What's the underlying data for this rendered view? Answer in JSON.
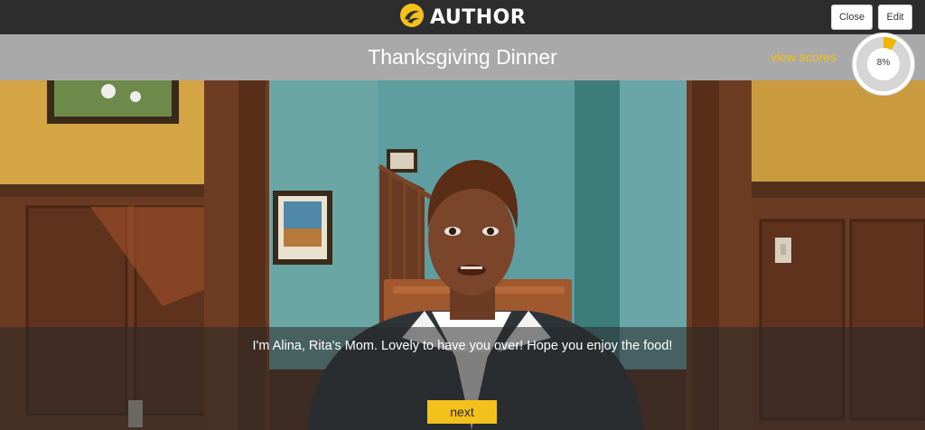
{
  "app": {
    "brand": "AUTHOR",
    "logo_icon": "author-logo-icon"
  },
  "header": {
    "close_label": "Close",
    "edit_label": "Edit"
  },
  "scene": {
    "title": "Thanksgiving Dinner",
    "view_scores_label": "view scores"
  },
  "progress": {
    "value": 0.08,
    "label": "8%"
  },
  "dialog": {
    "text": "I'm Alina, Rita's Mom. Lovely to have you over! Hope you enjoy the food!",
    "next_label": "next"
  },
  "colors": {
    "accent": "#f3c11b",
    "topbar": "#2d2d2d",
    "titlebar": "#a9a9a9"
  }
}
